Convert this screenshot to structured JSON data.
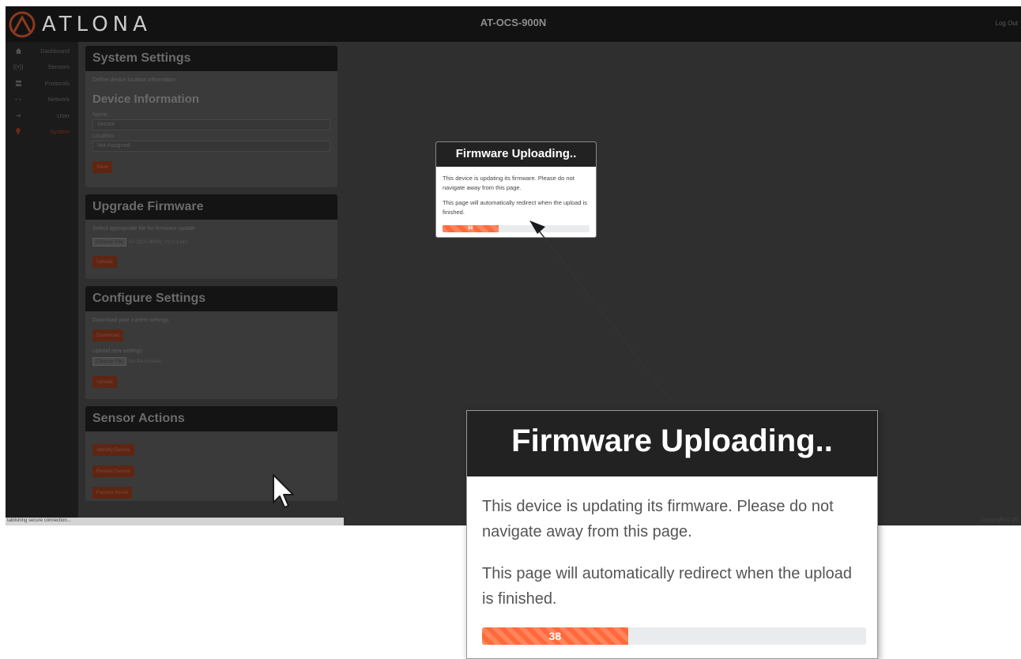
{
  "header": {
    "logo_text": "ATLONA",
    "device_title": "AT-OCS-900N",
    "logout_label": "Log Out"
  },
  "sidebar": {
    "items": [
      {
        "label": "Dashboard",
        "icon": "home-icon"
      },
      {
        "label": "Sensors",
        "icon": "sensor-icon"
      },
      {
        "label": "Protocols",
        "icon": "protocols-icon"
      },
      {
        "label": "Network",
        "icon": "network-icon"
      },
      {
        "label": "User",
        "icon": "user-icon"
      },
      {
        "label": "System",
        "icon": "system-icon",
        "active": true
      }
    ]
  },
  "system_settings": {
    "title": "System Settings",
    "description": "Define device location information",
    "device_info_title": "Device Information",
    "name_label": "Name:",
    "name_value": "Sensor",
    "location_label": "Location:",
    "location_value": "Not Assigned",
    "save_label": "Save"
  },
  "upgrade_firmware": {
    "title": "Upgrade Firmware",
    "description": "Select appropriate file for firmware update",
    "choose_file_label": "Choose File",
    "file_name": "AT-OCS-900N_V1.0.1.bin",
    "upload_label": "Upload"
  },
  "configure_settings": {
    "title": "Configure Settings",
    "download_description": "Download your current settings",
    "download_label": "Download",
    "upload_description": "Upload new settings",
    "choose_file_label": "Choose File",
    "no_file_text": "No file chosen",
    "upload_label": "Upload"
  },
  "sensor_actions": {
    "title": "Sensor Actions",
    "identify_label": "Identify Device",
    "restart_label": "Restart Device",
    "factory_reset_label": "Factory Reset"
  },
  "status_bar": {
    "text": "tablishing secure connection...",
    "copyright": "Copyright © 20"
  },
  "modal": {
    "title": "Firmware Uploading..",
    "text1": "This device is updating its firmware. Please do not navigate away from this page.",
    "text2": "This page will automatically redirect when the upload is finished.",
    "progress_label": "38",
    "progress_percent": 38,
    "progress_color": "#ff6a3a"
  },
  "modal_zoom": {
    "title": "Firmware Uploading..",
    "text1": "This device is updating its firmware. Please do not navigate away from this page.",
    "text2": "This page will automatically redirect when the upload is finished.",
    "progress_label": "38",
    "progress_percent": 38
  },
  "colors": {
    "brand_orange": "#e05a2a",
    "header_dark": "#222222"
  }
}
